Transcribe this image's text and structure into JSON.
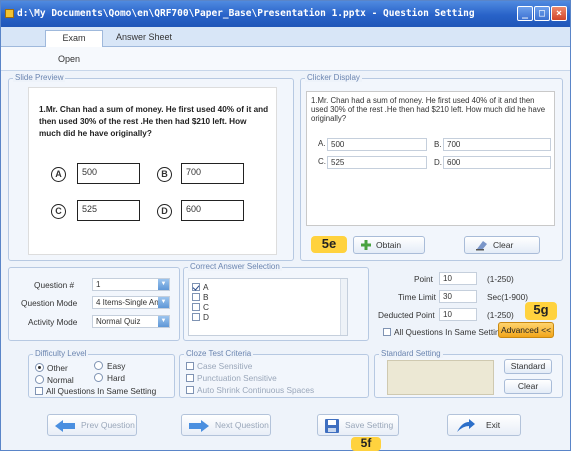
{
  "window": {
    "title": "d:\\My Documents\\Qomo\\en\\QRF700\\Paper_Base\\Presentation 1.pptx - Question Setting",
    "controls": {
      "minimize": "_",
      "maximize": "□",
      "close": "×"
    }
  },
  "tabs": [
    {
      "label": "Exam",
      "active": true
    },
    {
      "label": "Answer Sheet",
      "active": false
    }
  ],
  "ribbon": {
    "open_label": "Open"
  },
  "slide_preview": {
    "legend": "Slide Preview",
    "question": "1.Mr. Chan had a sum of money. He first used 40% of it and then used 30% of the rest .He then had $210 left. How much did he have originally?",
    "options": [
      {
        "letter": "A",
        "value": "500"
      },
      {
        "letter": "B",
        "value": "700"
      },
      {
        "letter": "C",
        "value": "525"
      },
      {
        "letter": "D",
        "value": "600"
      }
    ]
  },
  "clicker_display": {
    "legend": "Clicker Display",
    "question": "1.Mr. Chan had a sum of money. He first used 40% of it and then used 30% of the rest .He then had $210 left. How much did he have originally?",
    "options": [
      {
        "label": "A.",
        "value": "500"
      },
      {
        "label": "B.",
        "value": "700"
      },
      {
        "label": "C.",
        "value": "525"
      },
      {
        "label": "D.",
        "value": "600"
      }
    ],
    "callout": "5e",
    "obtain_label": "Obtain",
    "clear_label": "Clear"
  },
  "question_settings": {
    "question_number_label": "Question #",
    "question_number_value": "1",
    "question_mode_label": "Question Mode",
    "question_mode_value": "4 Items-Single An",
    "activity_mode_label": "Activity Mode",
    "activity_mode_value": "Normal Quiz"
  },
  "correct_answer": {
    "legend": "Correct Answer Selection",
    "items": [
      {
        "label": "A",
        "checked": true
      },
      {
        "label": "B",
        "checked": false
      },
      {
        "label": "C",
        "checked": false
      },
      {
        "label": "D",
        "checked": false
      }
    ]
  },
  "scoring": {
    "point_label": "Point",
    "point_value": "10",
    "point_range": "(1-250)",
    "time_limit_label": "Time Limit",
    "time_limit_value": "30",
    "time_limit_range": "Sec(1-900)",
    "deducted_label": "Deducted Point",
    "deducted_value": "10",
    "deducted_range": "(1-250)",
    "callout": "5g",
    "all_same_label": "All Questions In Same Setting",
    "advanced_label": "Advanced <<"
  },
  "difficulty": {
    "legend": "Difficulty Level",
    "options": [
      {
        "label": "Other",
        "selected": true
      },
      {
        "label": "Easy",
        "selected": false
      },
      {
        "label": "Normal",
        "selected": false
      },
      {
        "label": "Hard",
        "selected": false
      }
    ],
    "all_same_label": "All Questions In Same Setting"
  },
  "cloze": {
    "legend": "Cloze Test Criteria",
    "options": [
      "Case Sensitive",
      "Punctuation Sensitive",
      "Auto Shrink Continuous Spaces"
    ]
  },
  "standard_setting": {
    "legend": "Standard Setting",
    "standard_label": "Standard",
    "clear_label": "Clear"
  },
  "navigation": {
    "prev_label": "Prev Question",
    "next_label": "Next Question",
    "save_label": "Save Setting",
    "exit_label": "Exit",
    "callout": "5f"
  },
  "colors": {
    "titlebar": "#2862c8",
    "accent": "#4f8ae0",
    "callout": "#ffd23e",
    "advanced": "#f2a51a"
  }
}
